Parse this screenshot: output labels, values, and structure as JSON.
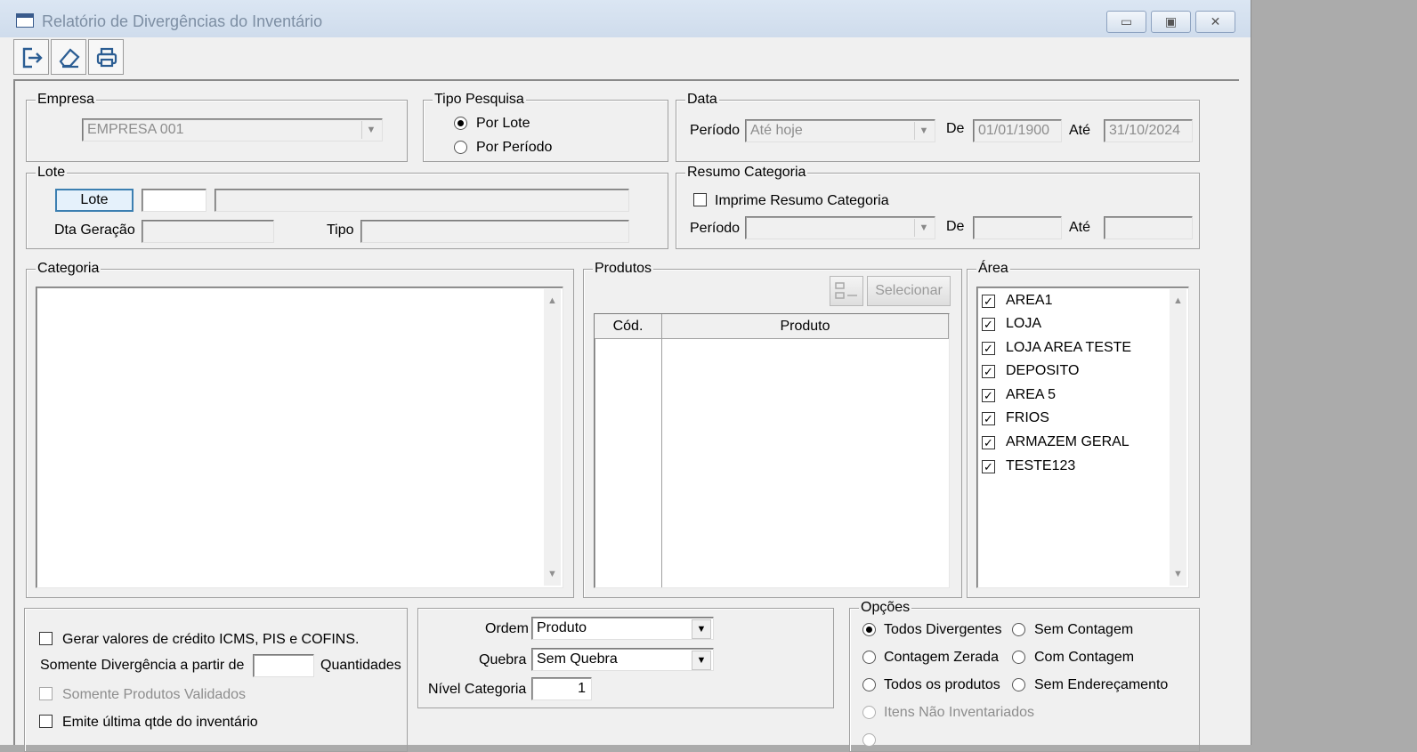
{
  "window": {
    "title": "Relatório de Divergências do Inventário"
  },
  "toolbar": {
    "exit_icon": "exit-icon",
    "clear_icon": "eraser-icon",
    "print_icon": "printer-icon"
  },
  "empresa": {
    "title": "Empresa",
    "value": "EMPRESA 001"
  },
  "tipo_pesquisa": {
    "title": "Tipo Pesquisa",
    "opt1": "Por Lote",
    "opt2": "Por Período",
    "selected": "Por Lote"
  },
  "data": {
    "title": "Data",
    "periodo_label": "Período",
    "periodo_value": "Até hoje",
    "de_label": "De",
    "de_value": "01/01/1900",
    "ate_label": "Até",
    "ate_value": "31/10/2024"
  },
  "lote": {
    "title": "Lote",
    "button": "Lote",
    "code": "",
    "desc": "",
    "dta_label": "Dta Geração",
    "dta_value": "",
    "tipo_label": "Tipo",
    "tipo_value": ""
  },
  "resumo": {
    "title": "Resumo Categoria",
    "check_label": "Imprime Resumo Categoria",
    "periodo_label": "Período",
    "de_label": "De",
    "ate_label": "Até"
  },
  "categoria": {
    "title": "Categoria"
  },
  "produtos": {
    "title": "Produtos",
    "select_button": "Selecionar",
    "col_cod": "Cód.",
    "col_produto": "Produto"
  },
  "area": {
    "title": "Área",
    "items": [
      "AREA1",
      "LOJA",
      "LOJA AREA TESTE",
      "DEPOSITO",
      "AREA 5",
      "FRIOS",
      "ARMAZEM GERAL",
      "TESTE123"
    ]
  },
  "filters": {
    "gerar_label": "Gerar valores de crédito ICMS, PIS e COFINS.",
    "somente_div_label": "Somente Divergência a partir de",
    "somente_div_value": "",
    "quantidades_label": "Quantidades",
    "somente_validados_label": "Somente Produtos Validados",
    "emite_label": "Emite última qtde do inventário"
  },
  "ordem": {
    "ordem_label": "Ordem",
    "ordem_value": "Produto",
    "quebra_label": "Quebra",
    "quebra_value": "Sem Quebra",
    "nivel_label": "Nível Categoria",
    "nivel_value": "1"
  },
  "opcoes": {
    "title": "Opções",
    "todos_divergentes": "Todos Divergentes",
    "sem_contagem": "Sem Contagem",
    "contagem_zerada": "Contagem Zerada",
    "com_contagem": "Com Contagem",
    "todos_produtos": "Todos os produtos",
    "sem_enderecamento": "Sem Endereçamento",
    "itens_nao_inventariados": "Itens Não Inventariados"
  }
}
